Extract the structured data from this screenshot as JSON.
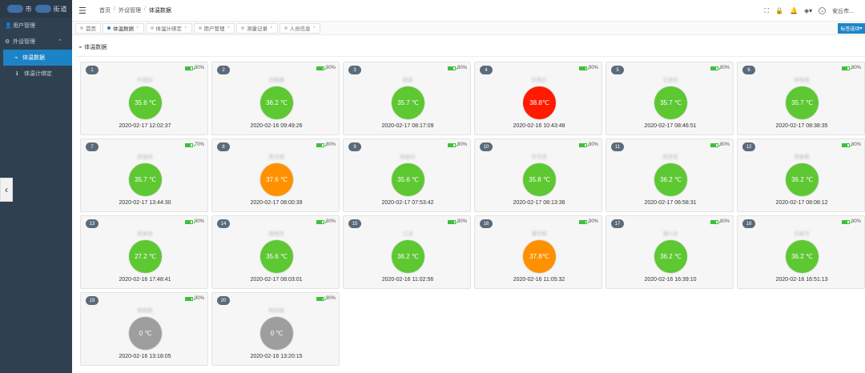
{
  "sidebar": {
    "logo_text": "市",
    "logo_text2": "街道",
    "items": [
      {
        "label": "用户管理",
        "icon": "user-icon"
      },
      {
        "label": "外设管理",
        "icon": "gear-icon"
      },
      {
        "label": "体温数据",
        "icon": "pulse-icon"
      },
      {
        "label": "体温计绑定",
        "icon": "info-icon"
      }
    ]
  },
  "header": {
    "breadcrumb": [
      "首页",
      "外设管理",
      "体温数据"
    ],
    "user_name": "安丘市..."
  },
  "tabs": [
    {
      "label": "首页"
    },
    {
      "label": "体温数据"
    },
    {
      "label": "体温计绑定"
    },
    {
      "label": "用户管理"
    },
    {
      "label": "测量记录"
    },
    {
      "label": "人员信息"
    }
  ],
  "tab_options_label": "标签选项",
  "section_title": "体温数据",
  "colors": {
    "normal": "#5dc832",
    "warning": "#ff9000",
    "fever": "#ff1a00",
    "offline": "#9e9e9e",
    "accent": "#1c84c6"
  },
  "cards": [
    {
      "index": "1",
      "battery": "80%",
      "name": "叶国庆",
      "temp": "35.6 ℃",
      "time": "2020-02-17 12:02:37",
      "status": "normal"
    },
    {
      "index": "2",
      "battery": "90%",
      "name": "刘丽娜",
      "temp": "36.2 ℃",
      "time": "2020-02-16 09:49:26",
      "status": "normal"
    },
    {
      "index": "3",
      "battery": "80%",
      "name": "周英",
      "temp": "35.7 ℃",
      "time": "2020-02-17 08:17:09",
      "status": "normal"
    },
    {
      "index": "4",
      "battery": "90%",
      "name": "刘秀红",
      "temp": "38.8℃",
      "time": "2020-02-16 10:43:48",
      "status": "fever"
    },
    {
      "index": "5",
      "battery": "80%",
      "name": "王丽华",
      "temp": "35.7 ℃",
      "time": "2020-02-17 08:46:51",
      "status": "normal"
    },
    {
      "index": "6",
      "battery": "80%",
      "name": "李晓燕",
      "temp": "35.7 ℃",
      "time": "2020-02-17 08:38:35",
      "status": "normal"
    },
    {
      "index": "7",
      "battery": "70%",
      "name": "周海亮",
      "temp": "35.7 ℃",
      "time": "2020-02-17 13:44:30",
      "status": "normal"
    },
    {
      "index": "8",
      "battery": "80%",
      "name": "周文强",
      "temp": "37.6 ℃",
      "time": "2020-02-17 08:00:39",
      "status": "warning"
    },
    {
      "index": "9",
      "battery": "80%",
      "name": "周春玲",
      "temp": "35.6 ℃",
      "time": "2020-02-17 07:53:42",
      "status": "normal"
    },
    {
      "index": "10",
      "battery": "80%",
      "name": "辛学成",
      "temp": "35.8 ℃",
      "time": "2020-02-17 08:13:36",
      "status": "normal"
    },
    {
      "index": "11",
      "battery": "80%",
      "name": "周贤军",
      "temp": "36.2 ℃",
      "time": "2020-02-17 06:58:31",
      "status": "normal"
    },
    {
      "index": "12",
      "battery": "80%",
      "name": "邢春艳",
      "temp": "36.2 ℃",
      "time": "2020-02-17 08:08:12",
      "status": "normal"
    },
    {
      "index": "13",
      "battery": "80%",
      "name": "周美依",
      "temp": "27.2 ℃",
      "time": "2020-02-16 17:48:41",
      "status": "normal"
    },
    {
      "index": "14",
      "battery": "80%",
      "name": "周晓然",
      "temp": "35.6 ℃",
      "time": "2020-02-17 08:03:01",
      "status": "normal"
    },
    {
      "index": "15",
      "battery": "90%",
      "name": "江涛",
      "temp": "36.2 ℃",
      "time": "2020-02-16 11:02:56",
      "status": "normal"
    },
    {
      "index": "16",
      "battery": "90%",
      "name": "潘学辉",
      "temp": "37.8℃",
      "time": "2020-02-16 11:05:32",
      "status": "warning"
    },
    {
      "index": "17",
      "battery": "80%",
      "name": "潘兴业",
      "temp": "36.2 ℃",
      "time": "2020-02-16 16:39:10",
      "status": "normal"
    },
    {
      "index": "18",
      "battery": "80%",
      "name": "刘喜月",
      "temp": "36.2 ℃",
      "time": "2020-02-16 16:51:13",
      "status": "normal"
    },
    {
      "index": "19",
      "battery": "90%",
      "name": "邢晓艳",
      "temp": "0 ℃",
      "time": "2020-02-16 13:18:05",
      "status": "offline"
    },
    {
      "index": "20",
      "battery": "90%",
      "name": "韩庆辉",
      "temp": "0 ℃",
      "time": "2020-02-16 13:20:15",
      "status": "offline"
    }
  ]
}
